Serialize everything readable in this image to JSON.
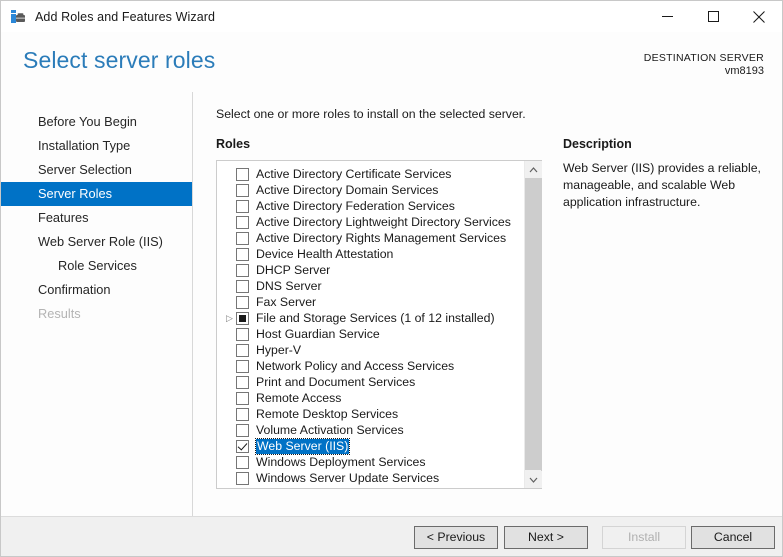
{
  "window": {
    "title": "Add Roles and Features Wizard",
    "icon": "server-toolbox-icon",
    "controls": {
      "minimize": "minimize-icon",
      "maximize": "maximize-icon",
      "close": "close-icon"
    }
  },
  "header": {
    "page_title": "Select server roles",
    "destination_label": "DESTINATION SERVER",
    "destination_value": "vm8193"
  },
  "sidebar": {
    "items": [
      {
        "label": "Before You Begin",
        "state": "normal",
        "sub": false
      },
      {
        "label": "Installation Type",
        "state": "normal",
        "sub": false
      },
      {
        "label": "Server Selection",
        "state": "normal",
        "sub": false
      },
      {
        "label": "Server Roles",
        "state": "active",
        "sub": false
      },
      {
        "label": "Features",
        "state": "normal",
        "sub": false
      },
      {
        "label": "Web Server Role (IIS)",
        "state": "normal",
        "sub": false
      },
      {
        "label": "Role Services",
        "state": "normal",
        "sub": true
      },
      {
        "label": "Confirmation",
        "state": "normal",
        "sub": false
      },
      {
        "label": "Results",
        "state": "disabled",
        "sub": false
      }
    ]
  },
  "main": {
    "instruction": "Select one or more roles to install on the selected server.",
    "roles_label": "Roles",
    "description_label": "Description",
    "description_text": "Web Server (IIS) provides a reliable, manageable, and scalable Web application infrastructure.",
    "roles": [
      {
        "label": "Active Directory Certificate Services",
        "checked": "none",
        "expandable": false,
        "selected": false
      },
      {
        "label": "Active Directory Domain Services",
        "checked": "none",
        "expandable": false,
        "selected": false
      },
      {
        "label": "Active Directory Federation Services",
        "checked": "none",
        "expandable": false,
        "selected": false
      },
      {
        "label": "Active Directory Lightweight Directory Services",
        "checked": "none",
        "expandable": false,
        "selected": false
      },
      {
        "label": "Active Directory Rights Management Services",
        "checked": "none",
        "expandable": false,
        "selected": false
      },
      {
        "label": "Device Health Attestation",
        "checked": "none",
        "expandable": false,
        "selected": false
      },
      {
        "label": "DHCP Server",
        "checked": "none",
        "expandable": false,
        "selected": false
      },
      {
        "label": "DNS Server",
        "checked": "none",
        "expandable": false,
        "selected": false
      },
      {
        "label": "Fax Server",
        "checked": "none",
        "expandable": false,
        "selected": false
      },
      {
        "label": "File and Storage Services (1 of 12 installed)",
        "checked": "partial",
        "expandable": true,
        "selected": false
      },
      {
        "label": "Host Guardian Service",
        "checked": "none",
        "expandable": false,
        "selected": false
      },
      {
        "label": "Hyper-V",
        "checked": "none",
        "expandable": false,
        "selected": false
      },
      {
        "label": "Network Policy and Access Services",
        "checked": "none",
        "expandable": false,
        "selected": false
      },
      {
        "label": "Print and Document Services",
        "checked": "none",
        "expandable": false,
        "selected": false
      },
      {
        "label": "Remote Access",
        "checked": "none",
        "expandable": false,
        "selected": false
      },
      {
        "label": "Remote Desktop Services",
        "checked": "none",
        "expandable": false,
        "selected": false
      },
      {
        "label": "Volume Activation Services",
        "checked": "none",
        "expandable": false,
        "selected": false
      },
      {
        "label": "Web Server (IIS)",
        "checked": "checked",
        "expandable": false,
        "selected": true
      },
      {
        "label": "Windows Deployment Services",
        "checked": "none",
        "expandable": false,
        "selected": false
      },
      {
        "label": "Windows Server Update Services",
        "checked": "none",
        "expandable": false,
        "selected": false
      }
    ],
    "scrollbar": {
      "up_arrow": "chevron-up-icon",
      "down_arrow": "chevron-down-icon"
    }
  },
  "footer": {
    "previous": "< Previous",
    "next": "Next >",
    "install": "Install",
    "cancel": "Cancel",
    "install_enabled": false
  },
  "colors": {
    "accent": "#0072c6",
    "title_blue": "#2b7cb9",
    "footer_bg": "#f0f0f0",
    "window_bg": "#fdfdfd"
  }
}
